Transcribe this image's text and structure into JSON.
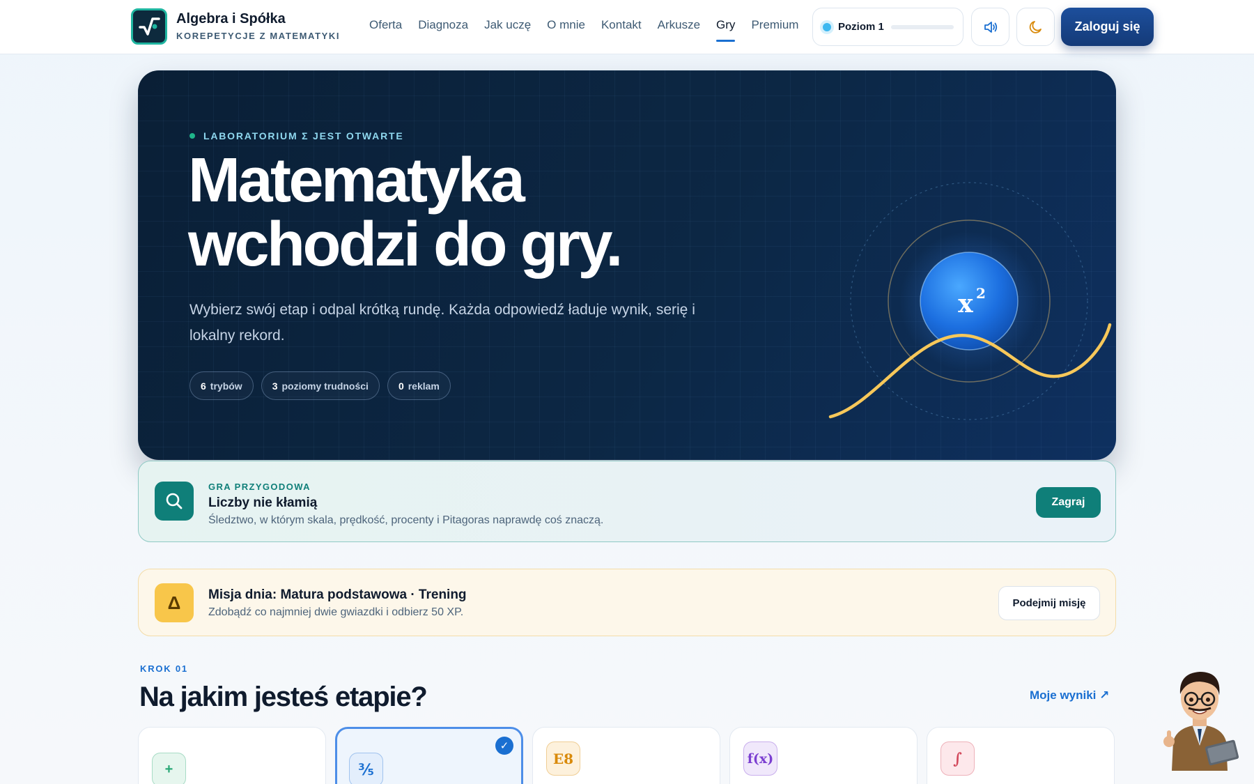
{
  "brand": {
    "name": "Algebra i Spółka",
    "tagline": "KOREPETYCJE Z MATEMATYKI"
  },
  "nav": {
    "items": [
      {
        "label": "Oferta"
      },
      {
        "label": "Diagnoza"
      },
      {
        "label": "Jak uczę"
      },
      {
        "label": "O mnie"
      },
      {
        "label": "Kontakt"
      },
      {
        "label": "Arkusze"
      },
      {
        "label": "Gry",
        "active": true
      },
      {
        "label": "Premium"
      }
    ]
  },
  "level": {
    "label": "Poziom 1",
    "progress": 0.0
  },
  "header": {
    "login_label": "Zaloguj się"
  },
  "hero": {
    "eyebrow": "LABORATORIUM Σ JEST OTWARTE",
    "title_line1": "Matematyka",
    "title_line2": "wchodzi do gry.",
    "subtitle": "Wybierz swój etap i odpal krótką rundę. Każda odpowiedź ładuje wynik, serię i lokalny rekord.",
    "stats": [
      {
        "num": "6",
        "label": "trybów"
      },
      {
        "num": "3",
        "label": "poziomy trudności"
      },
      {
        "num": "0",
        "label": "reklam"
      }
    ],
    "orb_symbol": "x",
    "orb_exponent": "2"
  },
  "adventure": {
    "eyebrow": "GRA PRZYGODOWA",
    "title": "Liczby nie kłamią",
    "description": "Śledztwo, w którym skala, prędkość, procenty i Pitagoras naprawdę coś znaczą.",
    "button": "Zagraj"
  },
  "mission": {
    "icon_symbol": "Δ",
    "title": "Misja dnia: Matura podstawowa · Trening",
    "description": "Zdobądź co najmniej dwie gwiazdki i odbierz 50 XP.",
    "button": "Podejmij misję"
  },
  "step": {
    "eyebrow": "KROK 01",
    "title": "Na jakim jesteś etapie?",
    "results_link": "Moje wyniki ↗",
    "stages": [
      {
        "symbol": "+",
        "color": "#2aa876",
        "bg": "#e6f6ee",
        "selected": false
      },
      {
        "symbol": "⅗",
        "color": "#1a6fd1",
        "bg": "#e3eefc",
        "selected": true,
        "check": "✓"
      },
      {
        "symbol": "E8",
        "color": "#d98a0a",
        "bg": "#fdf1dc",
        "selected": false
      },
      {
        "symbol": "f(x)",
        "color": "#7b3fd1",
        "bg": "#f0e8fb",
        "selected": false
      },
      {
        "symbol": "∫",
        "color": "#d2475a",
        "bg": "#fde8eb",
        "selected": false
      }
    ]
  }
}
